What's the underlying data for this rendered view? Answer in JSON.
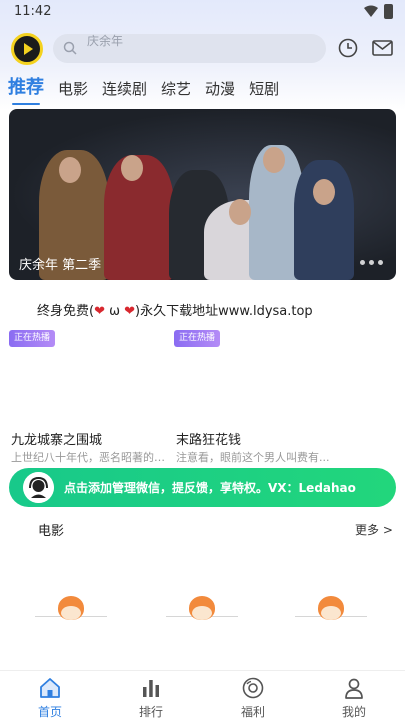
{
  "status_bar": {
    "time": "11:42"
  },
  "header": {
    "search_placeholder": "庆余年",
    "tabs": [
      "推荐",
      "电影",
      "连续剧",
      "综艺",
      "动漫",
      "短剧"
    ],
    "active_tab": 0
  },
  "banner": {
    "caption": "庆余年 第二季"
  },
  "notice": {
    "prefix": "终身免费(",
    "heart": "❤",
    "omega": " ω ",
    "suffix": ")永久下载地址www.ldysa.top"
  },
  "cards": [
    {
      "badge": "正在热播",
      "title": "九龙城寨之围城",
      "desc": "上世纪八十年代，恶名昭著的“..."
    },
    {
      "badge": "正在热播",
      "title": "末路狂花钱",
      "desc": "注意看，眼前这个男人叫费有..."
    }
  ],
  "wechat_banner": {
    "text": "点击添加管理微信，提反馈，享特权。VX：Ledahao"
  },
  "section": {
    "title": "电影",
    "more": "更多 >"
  },
  "nav": [
    {
      "label": "首页",
      "icon": "home-icon",
      "active": true
    },
    {
      "label": "排行",
      "icon": "ranking-icon",
      "active": false
    },
    {
      "label": "福利",
      "icon": "gift-disc-icon",
      "active": false
    },
    {
      "label": "我的",
      "icon": "profile-icon",
      "active": false
    }
  ],
  "colors": {
    "accent": "#2f7fe0",
    "wechat_green": "#1dcf84",
    "badge_purple": "#9c7bf4",
    "logo_yellow": "#f4d21f"
  }
}
